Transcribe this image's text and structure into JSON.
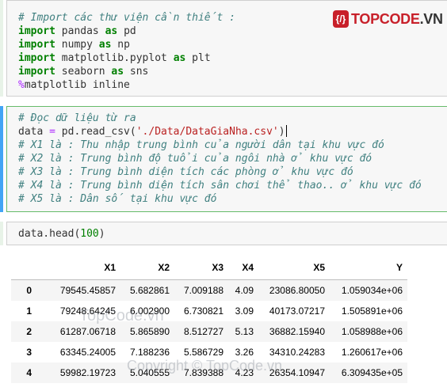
{
  "logo": {
    "badge": "{/}",
    "text_part1": "TOPCODE",
    "text_part2": ".VN"
  },
  "cell1": {
    "line1": "# Import các thư viện cần thiết :",
    "line2_kw": "import",
    "line2_mod": " pandas ",
    "line2_as": "as",
    "line2_alias": " pd",
    "line3_kw": "import",
    "line3_mod": " numpy ",
    "line3_as": "as",
    "line3_alias": " np",
    "line4_kw": "import",
    "line4_mod": " matplotlib.pyplot ",
    "line4_as": "as",
    "line4_alias": " plt",
    "line5_kw": "import",
    "line5_mod": " seaborn ",
    "line5_as": "as",
    "line5_alias": " sns",
    "line6_mag": "%",
    "line6_rest": "matplotlib inline"
  },
  "cell2": {
    "line1": "# Đọc dữ liệu từ ra",
    "line2_a": "data ",
    "line2_eq": "=",
    "line2_b": " pd.read_csv(",
    "line2_str": "'./Data/DataGiaNha.csv'",
    "line2_c": ")",
    "line3": "# X1 là : Thu nhập trung bình của người dân tại khu vực đó",
    "line4": "# X2 là : Trung bình độ tuổi của ngôi nhà ở khu vực đó",
    "line5": "# X3 là : Trung bình diện tích các phòng ở khu vực đó",
    "line6": "# X4 là : Trung bình diện tích sân chơi thể thao.. ở khu vực đó",
    "line7": "# X5 là : Dân số tại khu vực đó"
  },
  "cell3": {
    "code_a": "data.head(",
    "code_num": "100",
    "code_b": ")"
  },
  "table": {
    "columns": [
      "",
      "X1",
      "X2",
      "X3",
      "X4",
      "X5",
      "Y"
    ],
    "rows": [
      {
        "index": "0",
        "X1": "79545.45857",
        "X2": "5.682861",
        "X3": "7.009188",
        "X4": "4.09",
        "X5": "23086.80050",
        "Y": "1.059034e+06"
      },
      {
        "index": "1",
        "X1": "79248.64245",
        "X2": "6.002900",
        "X3": "6.730821",
        "X4": "3.09",
        "X5": "40173.07217",
        "Y": "1.505891e+06"
      },
      {
        "index": "2",
        "X1": "61287.06718",
        "X2": "5.865890",
        "X3": "8.512727",
        "X4": "5.13",
        "X5": "36882.15940",
        "Y": "1.058988e+06"
      },
      {
        "index": "3",
        "X1": "63345.24005",
        "X2": "7.188236",
        "X3": "5.586729",
        "X4": "3.26",
        "X5": "34310.24283",
        "Y": "1.260617e+06"
      },
      {
        "index": "4",
        "X1": "59982.19723",
        "X2": "5.040555",
        "X3": "7.839388",
        "X4": "4.23",
        "X5": "26354.10947",
        "Y": "6.309435e+05"
      }
    ]
  },
  "watermarks": {
    "w1": "TopCode.vn",
    "w2": "Copyright © TopCode.vn"
  },
  "colors": {
    "cell_bar": "#42a5f5",
    "keyword": "#008000",
    "comment": "#408080",
    "string": "#ba2121",
    "brand": "#c8202a"
  }
}
